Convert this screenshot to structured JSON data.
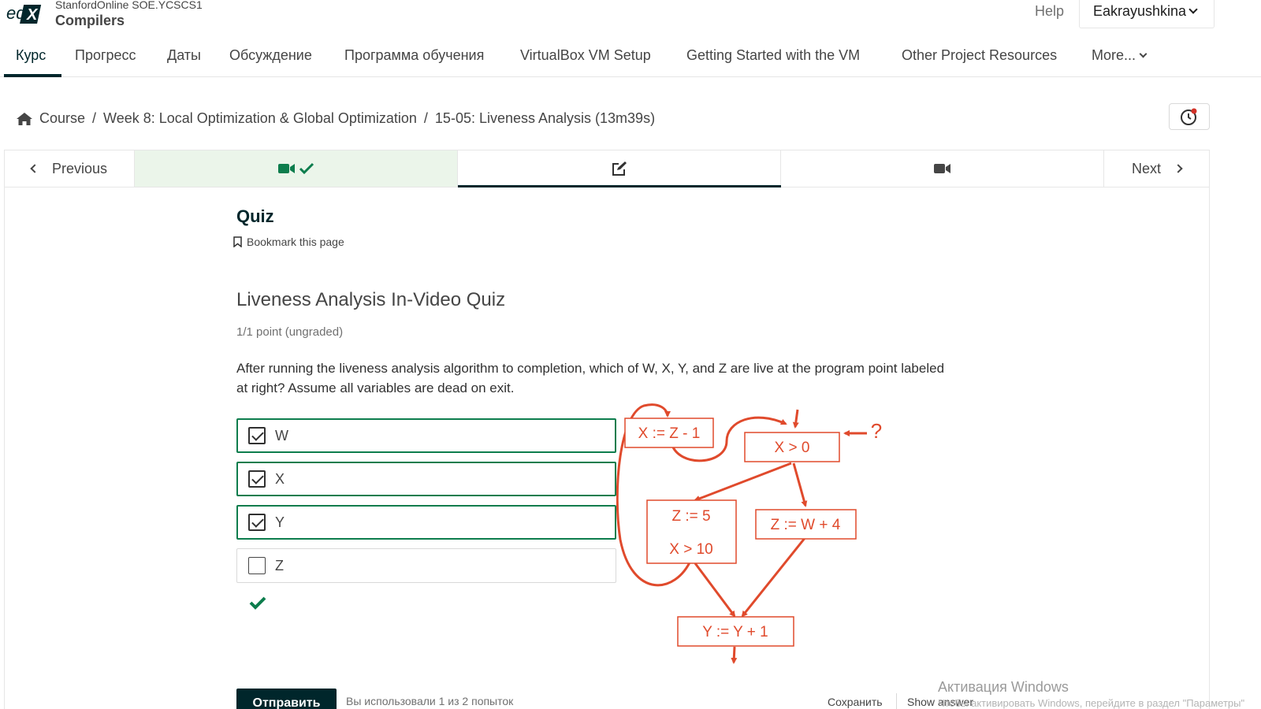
{
  "header": {
    "org": "StanfordOnline SOE.YCSCS1",
    "course_title": "Compilers",
    "help": "Help",
    "username": "Eakrayushkina"
  },
  "tabs": [
    "Курс",
    "Прогресс",
    "Даты",
    "Обсуждение",
    "Программа обучения",
    "VirtualBox VM Setup",
    "Getting Started with the VM",
    "Other Project Resources",
    "More..."
  ],
  "breadcrumb": {
    "home": "Course",
    "section": "Week 8: Local Optimization & Global Optimization",
    "unit": "15-05: Liveness Analysis (13m39s)"
  },
  "sequence": {
    "previous": "Previous",
    "next": "Next"
  },
  "unit": {
    "title": "Quiz",
    "bookmark": "Bookmark this page"
  },
  "problem": {
    "title": "Liveness Analysis In-Video Quiz",
    "points": "1/1 point (ungraded)",
    "prompt": "After running the liveness analysis algorithm to completion, which of W, X, Y, and Z are live at the program point labeled at right? Assume all variables are dead on exit.",
    "choices": [
      {
        "label": "W",
        "checked": true
      },
      {
        "label": "X",
        "checked": true
      },
      {
        "label": "Y",
        "checked": true
      },
      {
        "label": "Z",
        "checked": false
      }
    ]
  },
  "diagram": {
    "color": "#e04a2c",
    "nodes": [
      "X := Z - 1",
      "X > 0",
      "Z := 5",
      "X > 10",
      "Z := W + 4",
      "Y := Y + 1"
    ],
    "marker": "?"
  },
  "actions": {
    "submit": "Отправить",
    "attempts": "Вы использовали 1 из 2 попыток",
    "save": "Сохранить",
    "show_answer": "Show answer"
  },
  "watermark": {
    "title": "Активация Windows",
    "subtitle": "Чтобы активировать Windows, перейдите в раздел \"Параметры\""
  },
  "colors": {
    "brand": "#00262b",
    "success": "#0d7d4d",
    "visited_unit": "#ebf5ea"
  }
}
